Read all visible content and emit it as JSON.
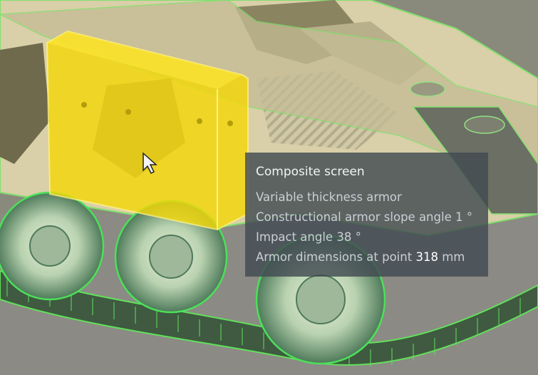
{
  "tooltip": {
    "title": "Composite screen",
    "line1": "Variable thickness armor",
    "line2": "Constructional armor slope angle 1 °",
    "line3": "Impact angle 38 °",
    "line4_prefix": "Armor dimensions at point ",
    "line4_value": "318",
    "line4_suffix": " mm"
  },
  "colors": {
    "highlight": "#f4d80a",
    "outline_green": "#5ee05a",
    "tooltip_bg": "#424a52"
  },
  "icons": [
    "mouse-pointer-icon"
  ]
}
